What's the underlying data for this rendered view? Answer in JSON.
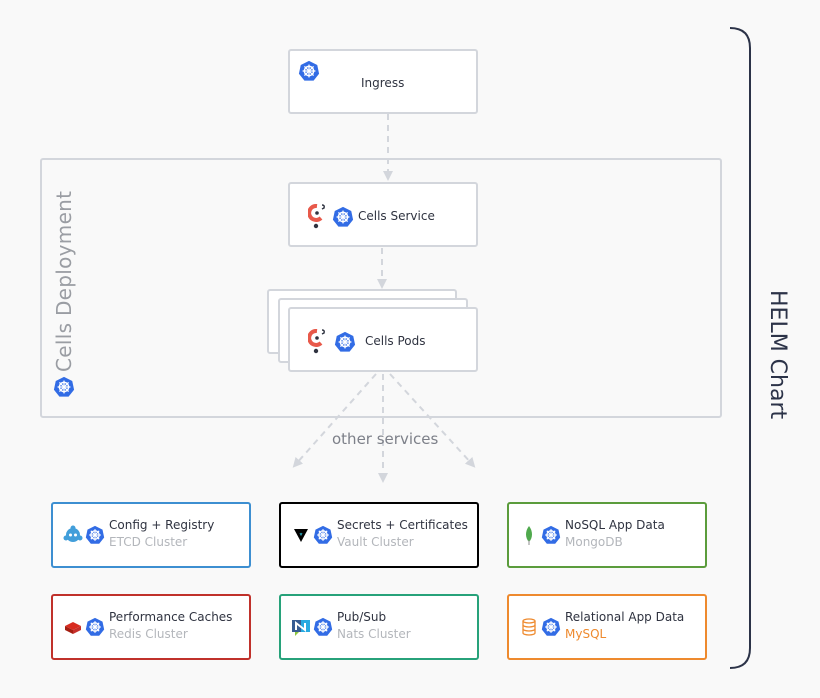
{
  "diagram": {
    "ingress": {
      "label": "Ingress",
      "icon": "kubernetes-icon"
    },
    "deployment": {
      "title": "Cells Deployment",
      "icon": "kubernetes-icon"
    },
    "cells_service": {
      "label": "Cells Service",
      "icons": [
        "cells-icon",
        "kubernetes-icon"
      ]
    },
    "cells_pods": {
      "label": "Cells Pods",
      "icons": [
        "cells-icon",
        "kubernetes-icon"
      ]
    },
    "other_services_label": "other services",
    "helm_label": "HELM Chart",
    "services": [
      {
        "title": "Config + Registry",
        "subtitle": "ETCD Cluster",
        "brand_icon": "etcd-icon",
        "border_color": "#3d8fd1",
        "subtitle_color": "#b3b6bb"
      },
      {
        "title": "Secrets + Certificates",
        "subtitle": "Vault Cluster",
        "brand_icon": "vault-icon",
        "border_color": "#000000",
        "subtitle_color": "#b3b6bb"
      },
      {
        "title": "NoSQL App Data",
        "subtitle": "MongoDB",
        "brand_icon": "mongodb-icon",
        "border_color": "#5b9c3c",
        "subtitle_color": "#b3b6bb"
      },
      {
        "title": "Performance Caches",
        "subtitle": "Redis Cluster",
        "brand_icon": "redis-icon",
        "border_color": "#c0312b",
        "subtitle_color": "#b3b6bb"
      },
      {
        "title": "Pub/Sub",
        "subtitle": "Nats Cluster",
        "brand_icon": "nats-icon",
        "border_color": "#27a27a",
        "subtitle_color": "#b3b6bb"
      },
      {
        "title": "Relational App Data",
        "subtitle": "MySQL",
        "brand_icon": "mysql-icon",
        "border_color": "#ee8a2e",
        "subtitle_color": "#ee8a2e"
      }
    ],
    "colors": {
      "kubernetes": "#326ce5",
      "box_border": "#d3d6dc",
      "arrow": "#d3d6dc",
      "bracket": "#2c3348"
    }
  }
}
